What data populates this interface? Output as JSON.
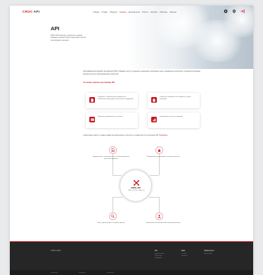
{
  "brand": {
    "logo_part1": "CROC",
    "logo_part2": "API"
  },
  "nav": {
    "links": [
      "Главная",
      "О банке",
      "Продукты",
      "Сервисы",
      "Документация",
      "Новости",
      "Контакты",
      "Партнеры",
      "Карьера"
    ],
    "active_index": 3
  },
  "hero": {
    "title": "API",
    "description": "CROC API позволяет подключить сервисы компании к вашим бизнес-процессам и быстро интегрировать решения."
  },
  "intro": {
    "text": "Программный интерфейс приложения (API) открывает доступ к данным и функциям платформы через стандартные протоколы, упрощая интеграцию внешних систем и автоматизацию процессов."
  },
  "features": {
    "heading": "Что можно сделать при помощи API",
    "items": [
      {
        "text": "Загружать и обрабатывать документы в автоматическом режиме без участия сотрудников",
        "icon": "document-icon"
      },
      {
        "text": "Управлять заявками и отслеживать статусы операций",
        "icon": "clipboard-icon"
      },
      {
        "text": "Получать уведомления о событиях",
        "icon": "mail-icon"
      },
      {
        "text": "Формировать отчеты и выгрузки",
        "icon": "chart-icon"
      }
    ]
  },
  "connect": {
    "text": "Чтобы начать работу, оставьте заявку на подключение и получите тестовый доступ к песочнице API.",
    "link_text": "Подробнее"
  },
  "diagram": {
    "hub_title": "CROC API",
    "hub_subtitle": "REST / JSON / OAuth 2.0",
    "nodes": [
      {
        "text": "Подключение к системам учета и обмен данными в реальном времени",
        "icon": "document-icon"
      },
      {
        "text": "Защищенная авторизация и контроль доступа",
        "icon": "lock-icon"
      },
      {
        "text": "Поиск, фильтрация и выгрузка данных",
        "icon": "search-icon"
      },
      {
        "text": "Управление пользователями и правами доступа",
        "icon": "user-icon"
      }
    ]
  },
  "footer": {
    "brand": "CROC 2024",
    "columns": [
      {
        "heading": "API",
        "items": [
          "Документация",
          "Песочница",
          "Поддержка"
        ]
      },
      {
        "heading": "Банк",
        "items": [
          "О банке",
          "Контакты"
        ]
      },
      {
        "heading": "Подписаться",
        "items": [
          "Новости API"
        ]
      }
    ]
  },
  "colors": {
    "accent": "#c8161d",
    "footer_bg": "#262626"
  }
}
